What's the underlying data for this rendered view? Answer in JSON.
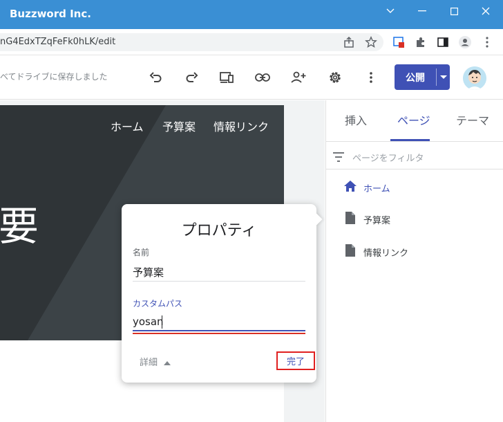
{
  "window": {
    "title": "Buzzword Inc.",
    "controls": [
      "chevron-down",
      "minimize",
      "maximize",
      "close"
    ]
  },
  "browser": {
    "url": "nG4EdxTZqFeFk0hLK/edit"
  },
  "toolbar": {
    "saved_status": "べてドライブに保存しました",
    "publish_label": "公開"
  },
  "hero": {
    "nav": [
      "ホーム",
      "予算案",
      "情報リンク"
    ],
    "big_text": "要"
  },
  "right_panel": {
    "tabs": [
      {
        "label": "挿入"
      },
      {
        "label": "ページ"
      },
      {
        "label": "テーマ"
      }
    ],
    "active_tab": "ページ",
    "filter_placeholder": "ページをフィルタ",
    "pages": [
      {
        "label": "ホーム",
        "icon": "home-icon",
        "active": true
      },
      {
        "label": "予算案",
        "icon": "page-icon",
        "active": false
      },
      {
        "label": "情報リンク",
        "icon": "page-icon",
        "active": false
      }
    ]
  },
  "dialog": {
    "title": "プロパティ",
    "name_label": "名前",
    "name_value": "予算案",
    "custom_path_label": "カスタムパス",
    "custom_path_value": "yosan",
    "details_label": "詳細",
    "done_label": "完了"
  },
  "colors": {
    "titlebar": "#3a8fd4",
    "accent": "#3f51b5",
    "highlight_border": "#e02020"
  }
}
